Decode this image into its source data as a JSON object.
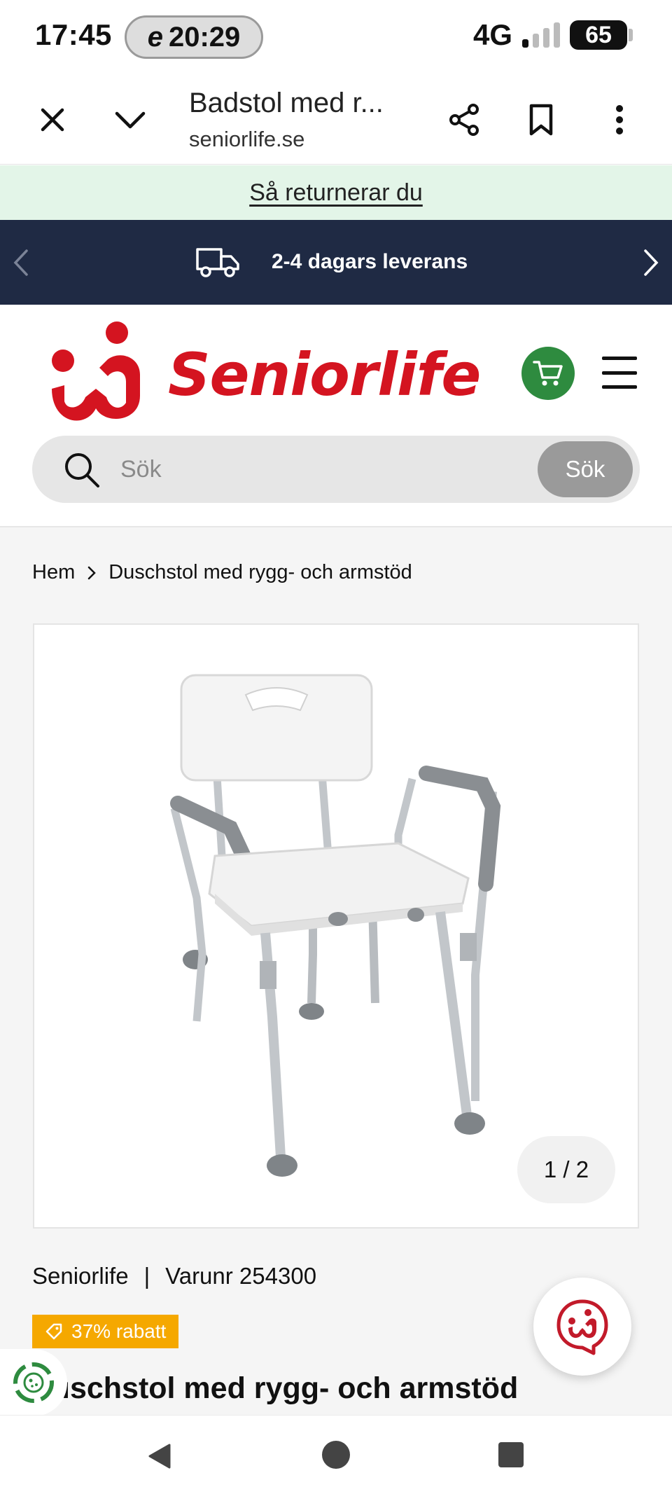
{
  "status_bar": {
    "time": "17:45",
    "pill_icon": "e",
    "pill_time": "20:29",
    "network": "4G",
    "battery": "65"
  },
  "browser": {
    "title": "Badstol med r...",
    "url": "seniorlife.se",
    "icons": [
      "close-icon",
      "chevron-down-icon",
      "share-icon",
      "bookmark-icon",
      "more-vert-icon"
    ]
  },
  "return_banner": {
    "label": "Så returnerar du"
  },
  "promo": {
    "text": "2-4 dagars leverans",
    "icon": "truck-icon"
  },
  "header": {
    "logo_text": "Seniorlife",
    "brand_color": "#d41420",
    "cart_color": "#2e8b3f"
  },
  "search": {
    "placeholder": "Sök",
    "value": "",
    "button_label": "Sök"
  },
  "breadcrumb": {
    "home": "Hem",
    "current": "Duschstol med rygg- och armstöd"
  },
  "gallery": {
    "counter": "1 / 2"
  },
  "product": {
    "brand": "Seniorlife",
    "divider": "|",
    "sku": "Varunr 254300",
    "discount": "37% rabatt",
    "discount_color": "#f5a800",
    "title": "ıschstol med rygg- och armstöd"
  }
}
